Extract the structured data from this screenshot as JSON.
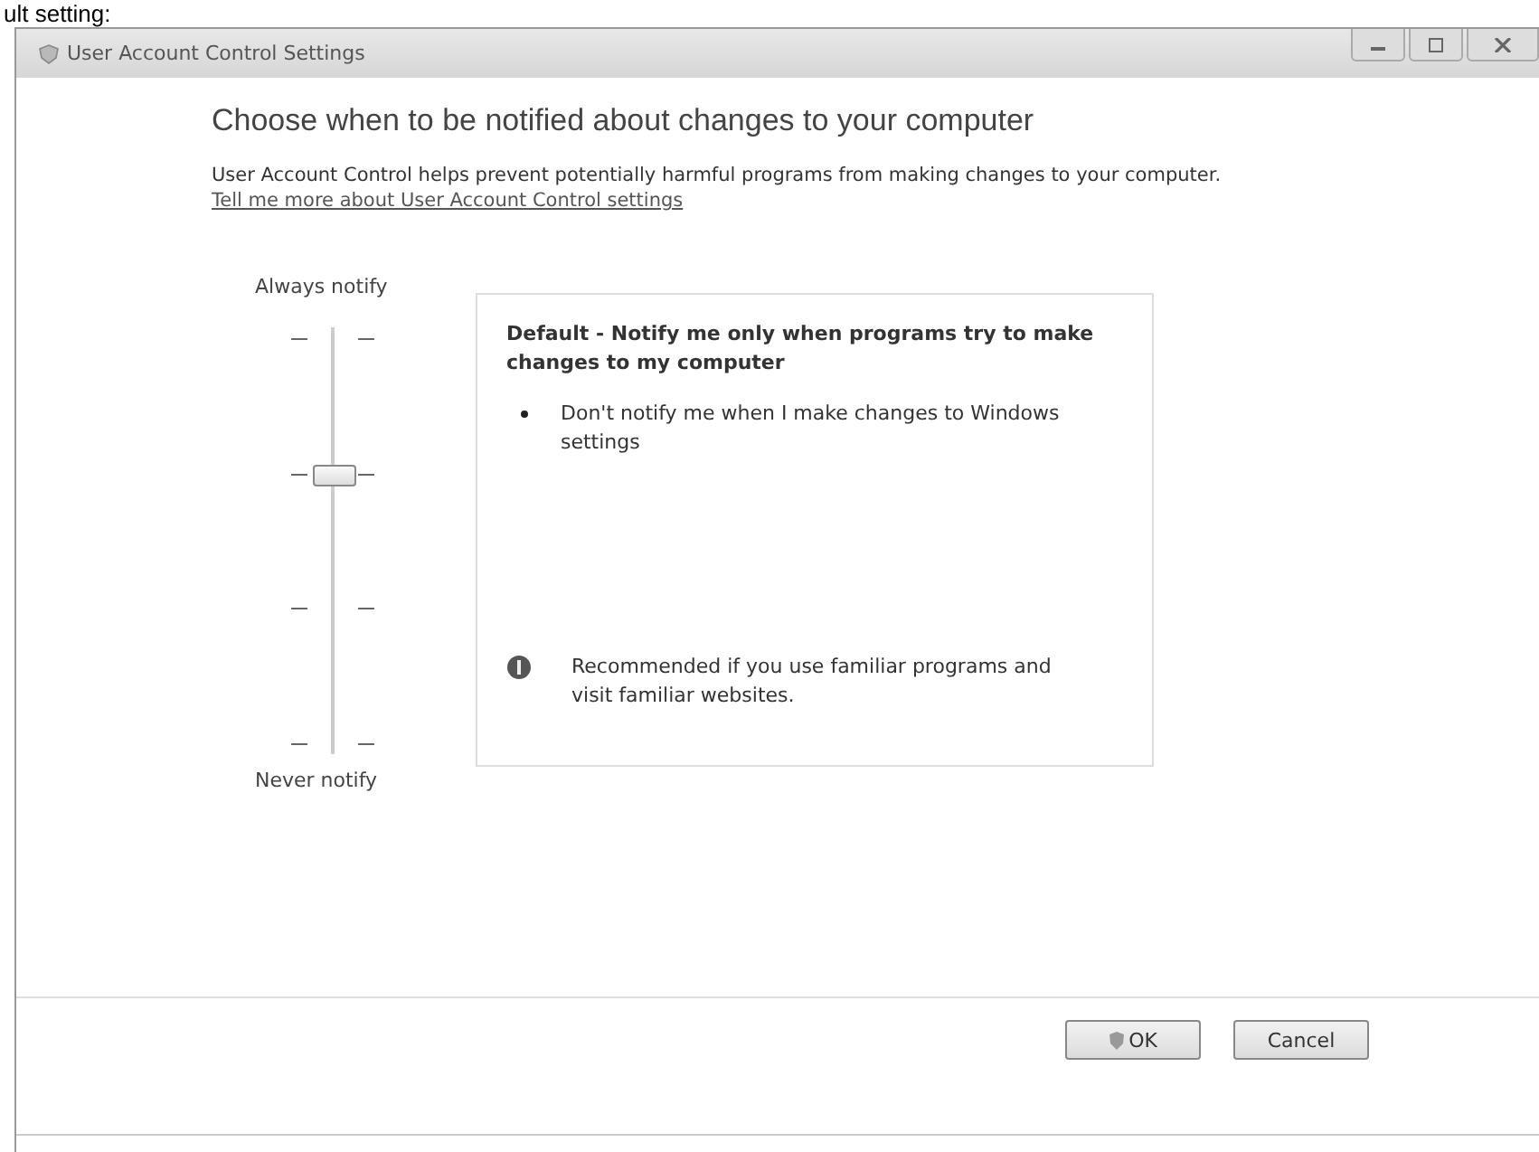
{
  "caption_fragment": "ult setting:",
  "window": {
    "title": "User Account Control Settings"
  },
  "heading": "Choose when to be notified about changes to your computer",
  "description": "User Account Control helps prevent potentially harmful programs from making changes to your computer.",
  "link": "Tell me more about User Account Control settings",
  "slider": {
    "top_label": "Always notify",
    "bottom_label": "Never notify",
    "level": 0.667
  },
  "setting": {
    "title": "Default - Notify me only when programs try to make changes to my computer",
    "bullets": [
      "Don't notify me when I make changes to Windows settings"
    ],
    "note": "Recommended if you use familiar programs and visit familiar websites."
  },
  "buttons": [
    {
      "label": "OK",
      "shield": true
    },
    {
      "label": "Cancel",
      "shield": false
    }
  ]
}
